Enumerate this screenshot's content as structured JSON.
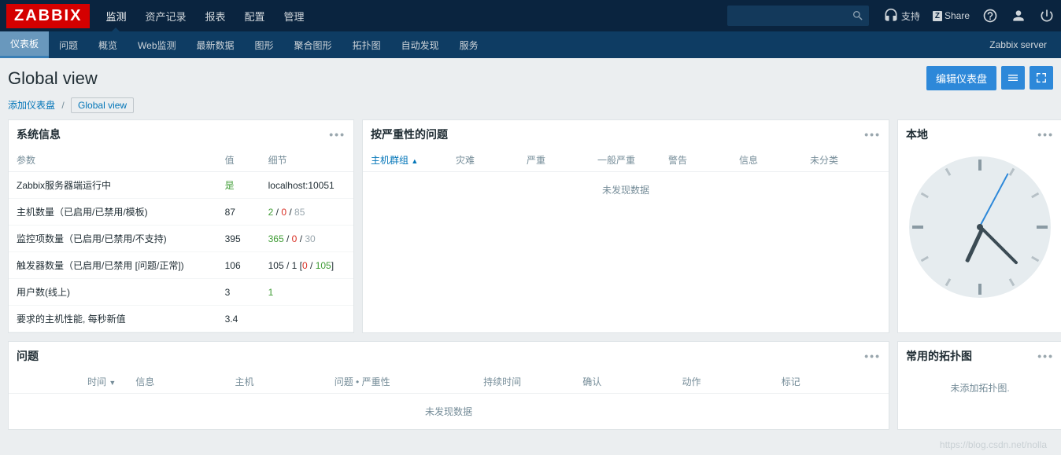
{
  "logo": "ZABBIX",
  "topnav": {
    "items": [
      "监测",
      "资产记录",
      "报表",
      "配置",
      "管理"
    ],
    "active": 0,
    "search_placeholder": "",
    "support": "支持",
    "share": "Share"
  },
  "subnav": {
    "items": [
      "仪表板",
      "问题",
      "概览",
      "Web监测",
      "最新数据",
      "图形",
      "聚合图形",
      "拓扑图",
      "自动发现",
      "服务"
    ],
    "active": 0,
    "right": "Zabbix server"
  },
  "page_title": "Global view",
  "edit_btn": "编辑仪表盘",
  "breadcrumb": {
    "root": "添加仪表盘",
    "current": "Global view"
  },
  "sysinfo": {
    "title": "系统信息",
    "cols": [
      "参数",
      "值",
      "细节"
    ],
    "rows": [
      {
        "param": "Zabbix服务器端运行中",
        "value_html": [
          {
            "t": "是",
            "c": "val-green"
          }
        ],
        "detail_html": [
          {
            "t": "localhost:10051",
            "c": ""
          }
        ]
      },
      {
        "param": "主机数量（已启用/已禁用/模板)",
        "value_html": [
          {
            "t": "87",
            "c": ""
          }
        ],
        "detail_html": [
          {
            "t": "2",
            "c": "val-green"
          },
          {
            "t": " / ",
            "c": ""
          },
          {
            "t": "0",
            "c": "val-red"
          },
          {
            "t": " / ",
            "c": ""
          },
          {
            "t": "85",
            "c": "val-gray"
          }
        ]
      },
      {
        "param": "监控项数量（已启用/已禁用/不支持)",
        "value_html": [
          {
            "t": "395",
            "c": ""
          }
        ],
        "detail_html": [
          {
            "t": "365",
            "c": "val-green"
          },
          {
            "t": " / ",
            "c": ""
          },
          {
            "t": "0",
            "c": "val-red"
          },
          {
            "t": " / ",
            "c": ""
          },
          {
            "t": "30",
            "c": "val-gray"
          }
        ]
      },
      {
        "param": "触发器数量（已启用/已禁用 [问题/正常])",
        "value_html": [
          {
            "t": "106",
            "c": ""
          }
        ],
        "detail_html": [
          {
            "t": "105 / 1 [",
            "c": ""
          },
          {
            "t": "0",
            "c": "val-red"
          },
          {
            "t": " / ",
            "c": ""
          },
          {
            "t": "105",
            "c": "val-green"
          },
          {
            "t": "]",
            "c": ""
          }
        ]
      },
      {
        "param": "用户数(线上)",
        "value_html": [
          {
            "t": "3",
            "c": ""
          }
        ],
        "detail_html": [
          {
            "t": "1",
            "c": "val-green"
          }
        ]
      },
      {
        "param": "要求的主机性能, 每秒新值",
        "value_html": [
          {
            "t": "3.4",
            "c": ""
          }
        ],
        "detail_html": []
      }
    ]
  },
  "severity": {
    "title": "按严重性的问题",
    "cols": [
      "主机群组",
      "灾难",
      "严重",
      "一般严重",
      "警告",
      "信息",
      "未分类"
    ],
    "sort_col": 0,
    "empty": "未发现数据"
  },
  "clock": {
    "title": "本地"
  },
  "problems": {
    "title": "问题",
    "cols": [
      "时间",
      "信息",
      "主机",
      "问题 • 严重性",
      "持续时间",
      "确认",
      "动作",
      "标记"
    ],
    "sort_col": 0,
    "empty": "未发现数据"
  },
  "maps": {
    "title": "常用的拓扑图",
    "empty": "未添加拓扑图."
  },
  "watermark": "https://blog.csdn.net/nolla"
}
